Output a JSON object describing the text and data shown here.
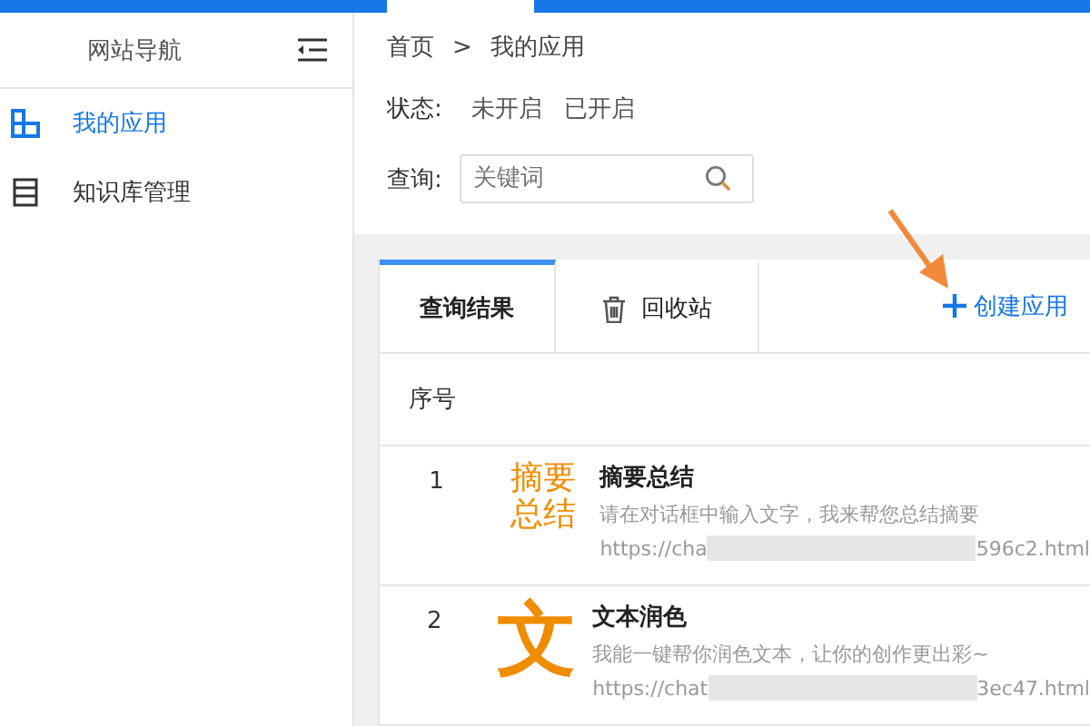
{
  "sidebar": {
    "title": "网站导航",
    "items": [
      {
        "label": "我的应用",
        "selected": true
      },
      {
        "label": "知识库管理",
        "selected": false
      }
    ]
  },
  "breadcrumb": [
    "首页",
    ">",
    "我的应用"
  ],
  "filters": {
    "status_label": "状态:",
    "status_options": [
      "未开启",
      "已开启"
    ],
    "query_label": "查询:",
    "search": {
      "placeholder": "关键词"
    }
  },
  "tabs": [
    {
      "label": "查询结果",
      "selected": true
    },
    {
      "label": "回收站",
      "selected": false
    }
  ],
  "create_button": {
    "label": "创建应用"
  },
  "table": {
    "columns": [
      "序号"
    ],
    "rows": [
      {
        "index": "1",
        "logo": {
          "kind": "text",
          "lines": [
            "摘要",
            "总结"
          ]
        },
        "title": "摘要总结",
        "description": "请在对话框中输入文字，我来帮您总结摘要",
        "url_start": "https://cha",
        "url_end": "596c2.html"
      },
      {
        "index": "2",
        "logo": {
          "kind": "glyph",
          "lines": [
            "文"
          ]
        },
        "title": "文本润色",
        "description": "我能一键帮你润色文本，让你的创作更出彩~",
        "url_start": "https://chat",
        "url_end": "3ec47.html"
      }
    ]
  }
}
